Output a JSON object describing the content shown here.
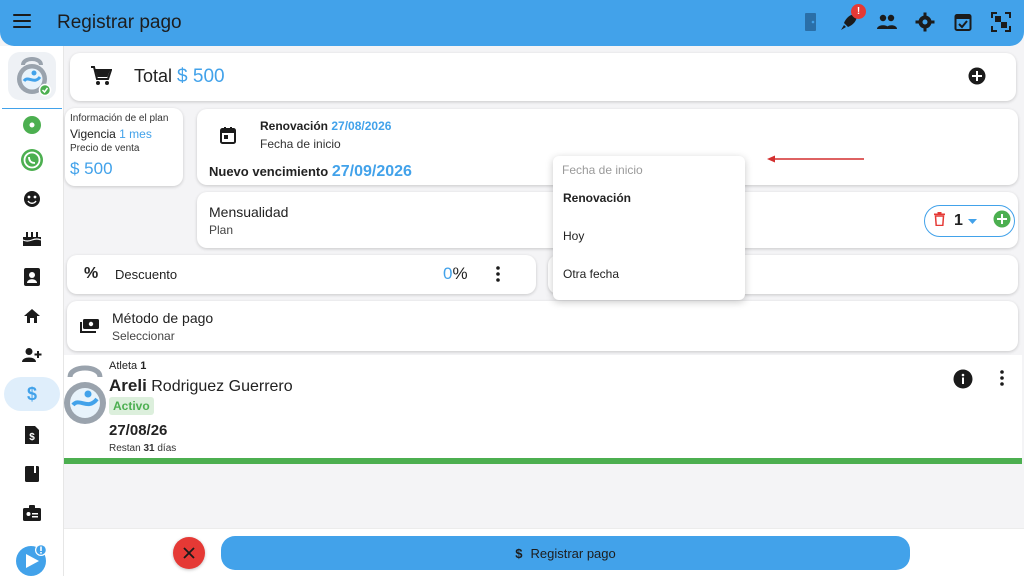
{
  "appbar": {
    "title": "Registrar pago",
    "notification_badge": "!",
    "icons": [
      "door-icon",
      "rocket-icon",
      "people-icon",
      "gear-icon",
      "calendar-check-icon",
      "qr-scan-icon"
    ]
  },
  "sidebar": {
    "items": [
      "status-dot-icon",
      "whatsapp-icon",
      "face-icon",
      "cake-icon",
      "contact-card-icon",
      "home-icon",
      "add-person-icon",
      "dollar-icon",
      "invoice-icon",
      "book-icon",
      "badge-icon",
      "help-icon"
    ],
    "help_badge": "!"
  },
  "total": {
    "label": "Total",
    "value": "$ 500"
  },
  "plan": {
    "info_label": "Información de el plan",
    "vigencia_label": "Vigencia",
    "vigencia_value": "1 mes",
    "price_label": "Precio de venta",
    "price_value": "$ 500"
  },
  "renewal": {
    "label": "Renovación",
    "date": "27/08/2026",
    "start_label": "Fecha de inicio",
    "new_expiry_label": "Nuevo vencimiento",
    "new_expiry_value": "27/09/2026"
  },
  "dropdown": {
    "header": "Fecha de inicio",
    "options": [
      "Renovación",
      "Hoy",
      "Otra fecha"
    ],
    "selected": "Renovación"
  },
  "item": {
    "title": "Mensualidad",
    "subtitle": "Plan",
    "quantity": "1"
  },
  "discount": {
    "label": "Descuento",
    "value": "0",
    "unit": "%"
  },
  "payment": {
    "label": "Método de pago",
    "value": "Seleccionar"
  },
  "athlete": {
    "label": "Atleta",
    "number": "1",
    "first_name": "Areli",
    "last_name": "Rodriguez Guerrero",
    "status": "Activo",
    "date": "27/08/26",
    "remaining_prefix": "Restan",
    "remaining_days": "31",
    "remaining_suffix": "días"
  },
  "actions": {
    "register_label": "Registrar pago"
  },
  "colors": {
    "primary": "#42a2ea",
    "success": "#4caf50",
    "danger": "#e53935"
  }
}
